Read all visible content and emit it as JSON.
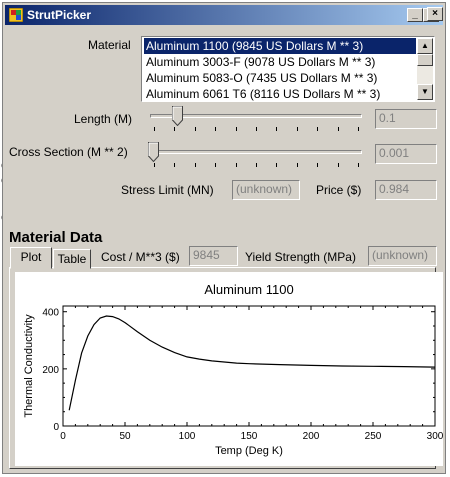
{
  "window": {
    "title": "StrutPicker",
    "min_label": "_",
    "max_label": "□",
    "close_label": "×"
  },
  "material": {
    "label": "Material",
    "items": [
      "Aluminum 1100 (9845 US Dollars M ** 3)",
      "Aluminum 3003-F (9078 US Dollars M ** 3)",
      "Aluminum 5083-O (7435 US Dollars M ** 3)",
      "Aluminum 6061 T6 (8116 US Dollars M ** 3)"
    ],
    "selected_index": 0
  },
  "length": {
    "label": "Length (M)",
    "value": "0.1",
    "slider_fraction": 0.12
  },
  "cross_section": {
    "label": "Cross Section (M ** 2)",
    "value": "0.001",
    "slider_fraction": 0.0
  },
  "stress_limit": {
    "label": "Stress Limit (MN)",
    "value": "(unknown)"
  },
  "price": {
    "label": "Price ($)",
    "value": "0.984"
  },
  "material_data": {
    "title": "Material Data",
    "tabs": [
      "Plot",
      "Table"
    ],
    "active_tab": "Plot",
    "cost_label": "Cost / M**3 ($)",
    "cost_value": "9845",
    "yield_label": "Yield Strength (MPa)",
    "yield_value": "(unknown)"
  },
  "background_fragments": [
    "e",
    "e",
    "e"
  ],
  "chart_data": {
    "type": "line",
    "title": "Aluminum 1100",
    "xlabel": "Temp (Deg K)",
    "ylabel": "Thermal Conductivity",
    "xlim": [
      0,
      300
    ],
    "ylim": [
      0,
      420
    ],
    "xticks": [
      0,
      50,
      100,
      150,
      200,
      250,
      300
    ],
    "yticks": [
      0,
      200,
      400
    ],
    "grid": false,
    "series": [
      {
        "color": "#000000",
        "x": [
          5,
          10,
          15,
          20,
          25,
          30,
          35,
          40,
          45,
          50,
          60,
          70,
          80,
          90,
          100,
          110,
          120,
          130,
          140,
          150,
          175,
          200,
          225,
          250,
          275,
          300
        ],
        "y": [
          55,
          160,
          255,
          315,
          355,
          378,
          385,
          383,
          375,
          362,
          330,
          300,
          276,
          257,
          242,
          234,
          228,
          224,
          220,
          218,
          215,
          212,
          210,
          209,
          208,
          206
        ]
      }
    ]
  }
}
